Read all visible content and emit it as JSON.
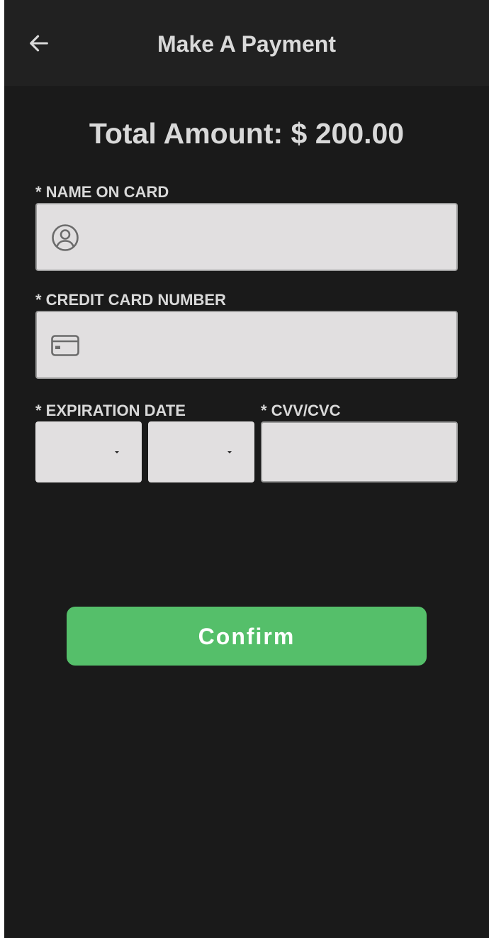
{
  "header": {
    "title": "Make A Payment",
    "back_icon": "arrow-left-icon"
  },
  "payment": {
    "total_text": "Total Amount: $ 200.00"
  },
  "form": {
    "name_label": "* NAME ON CARD",
    "name_value": "",
    "name_icon": "user-circle-icon",
    "card_label": "* CREDIT CARD NUMBER",
    "card_value": "",
    "card_icon": "credit-card-icon",
    "expiration_label": "* EXPIRATION DATE",
    "exp_month_value": "",
    "exp_year_value": "",
    "cvv_label": "* CVV/CVC",
    "cvv_value": ""
  },
  "actions": {
    "confirm_label": "Confirm"
  },
  "colors": {
    "background": "#1a1a1a",
    "header": "#212121",
    "field": "#e1dfe0",
    "text": "#d9d9d9",
    "accent": "#55bf6a"
  }
}
